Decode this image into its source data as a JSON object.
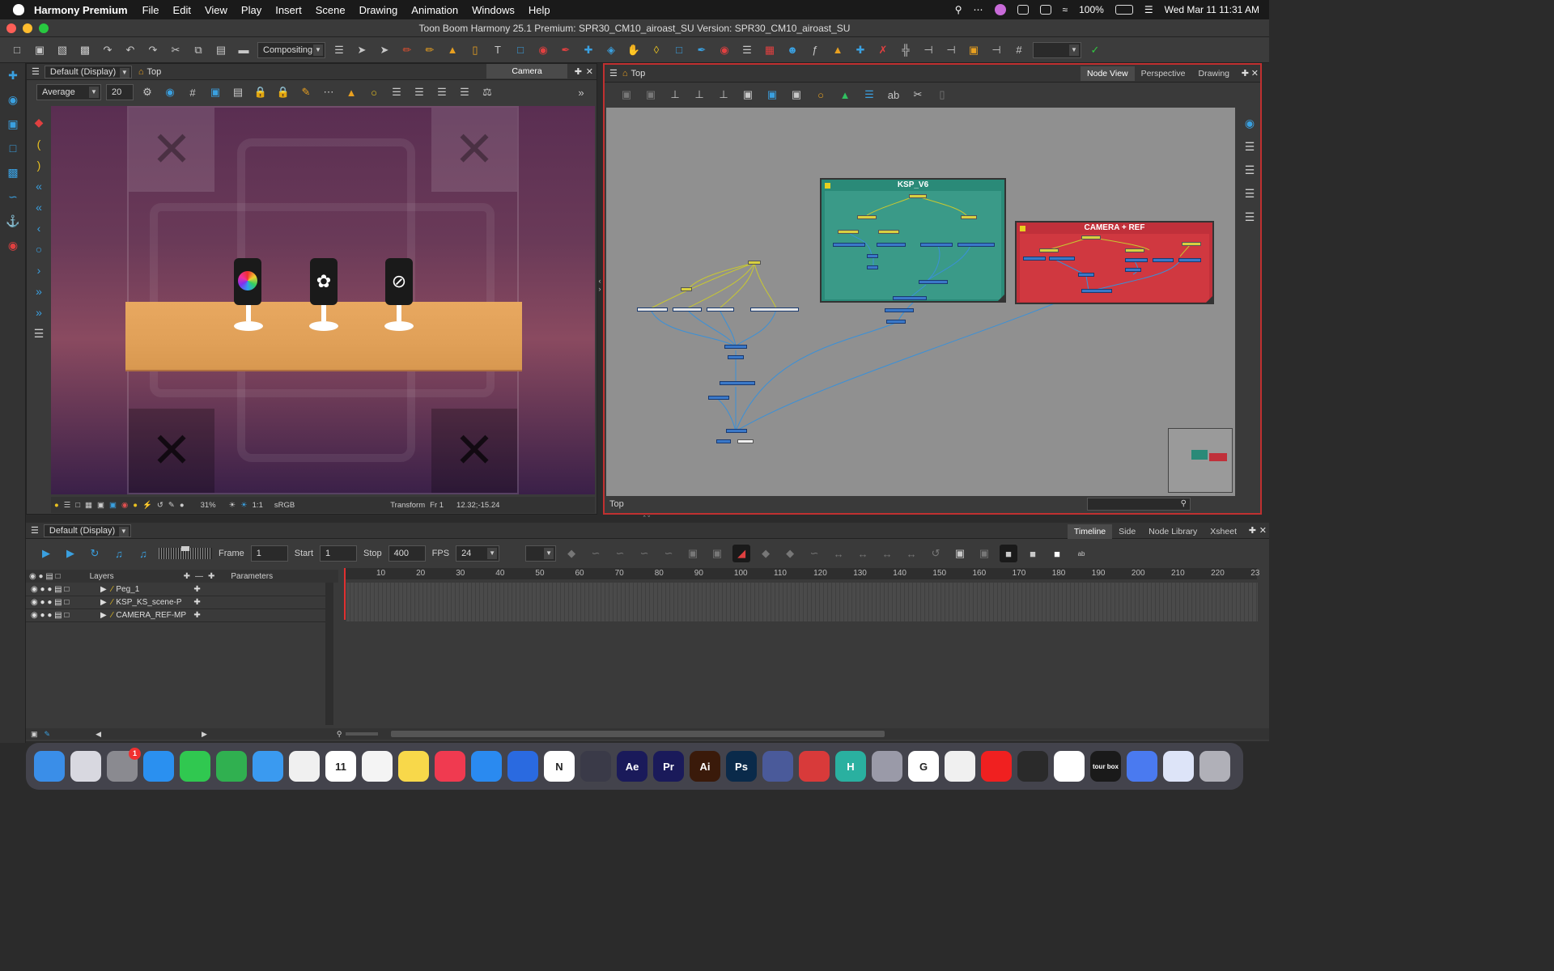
{
  "menubar": {
    "app_name": "Harmony Premium",
    "items": [
      "File",
      "Edit",
      "View",
      "Play",
      "Insert",
      "Scene",
      "Drawing",
      "Animation",
      "Windows",
      "Help"
    ],
    "battery": "100%",
    "clock": "Wed Mar 11  11:31 AM"
  },
  "window": {
    "title": "Toon Boom Harmony 25.1 Premium: SPR30_CM10_airoast_SU Version: SPR30_CM10_airoast_SU"
  },
  "toolbar": {
    "workspace": "Compositing"
  },
  "camera_panel": {
    "display": "Default (Display)",
    "breadcrumb": "Top",
    "tab": "Camera",
    "filter": "Average",
    "filter_value": "20",
    "zoom": "31%",
    "ratio": "1:1",
    "colorspace": "sRGB",
    "status_tool": "Transform",
    "status_frame": "Fr 1",
    "status_coords": "12.32;-15.24"
  },
  "node_panel": {
    "breadcrumb": "Top",
    "tabs": [
      "Node View",
      "Perspective",
      "Drawing"
    ],
    "active_tab": "Node View",
    "footer_label": "Top",
    "groups": [
      {
        "name": "KSP_V6",
        "color": "#2a8a78"
      },
      {
        "name": "CAMERA + REF",
        "color": "#c0303a"
      }
    ]
  },
  "timeline_panel": {
    "display": "Default (Display)",
    "tabs": [
      "Timeline",
      "Side",
      "Node Library",
      "Xsheet"
    ],
    "active_tab": "Timeline",
    "frame_label": "Frame",
    "frame_value": "1",
    "start_label": "Start",
    "start_value": "1",
    "stop_label": "Stop",
    "stop_value": "400",
    "fps_label": "FPS",
    "fps_value": "24",
    "layers_header": "Layers",
    "params_header": "Parameters",
    "layers": [
      "Peg_1",
      "KSP_KS_scene-P",
      "CAMERA_REF-MP"
    ],
    "ruler_ticks": [
      "10",
      "20",
      "30",
      "40",
      "50",
      "60",
      "70",
      "80",
      "90",
      "100",
      "110",
      "120",
      "130",
      "140",
      "150",
      "160",
      "170",
      "180",
      "190",
      "200",
      "210",
      "220",
      "23"
    ]
  },
  "dock": {
    "apps": [
      {
        "name": "finder",
        "label": "",
        "color": "#3a8ee8"
      },
      {
        "name": "launchpad",
        "label": "",
        "color": "#d8d8e0"
      },
      {
        "name": "system-settings",
        "label": "",
        "color": "#8a8a90",
        "badge": "1"
      },
      {
        "name": "safari",
        "label": "",
        "color": "#2a90f0"
      },
      {
        "name": "messages",
        "label": "",
        "color": "#30c850"
      },
      {
        "name": "facetime",
        "label": "",
        "color": "#30b050"
      },
      {
        "name": "mail",
        "label": "",
        "color": "#3a9af0"
      },
      {
        "name": "photos",
        "label": "",
        "color": "#f0f0f0"
      },
      {
        "name": "calendar",
        "label": "11",
        "color": "#ffffff"
      },
      {
        "name": "reminders",
        "label": "",
        "color": "#f4f4f4"
      },
      {
        "name": "notes",
        "label": "",
        "color": "#f8d84a"
      },
      {
        "name": "music",
        "label": "",
        "color": "#f03a50"
      },
      {
        "name": "app-store",
        "label": "",
        "color": "#2a8af0"
      },
      {
        "name": "things",
        "label": "",
        "color": "#2a6ae0"
      },
      {
        "name": "notion",
        "label": "N",
        "color": "#ffffff"
      },
      {
        "name": "activity",
        "label": "",
        "color": "#3a3a48"
      },
      {
        "name": "after-effects",
        "label": "Ae",
        "color": "#1a1a5a"
      },
      {
        "name": "premiere",
        "label": "Pr",
        "color": "#1a1a5a"
      },
      {
        "name": "illustrator",
        "label": "Ai",
        "color": "#3a1a0a"
      },
      {
        "name": "photoshop",
        "label": "Ps",
        "color": "#0a2a4a"
      },
      {
        "name": "remote",
        "label": "",
        "color": "#4a5a9a"
      },
      {
        "name": "scrobbler",
        "label": "",
        "color": "#d83a3a"
      },
      {
        "name": "h-app",
        "label": "H",
        "color": "#2ab0a0"
      },
      {
        "name": "keychain",
        "label": "",
        "color": "#9a9aa8"
      },
      {
        "name": "chrome",
        "label": "G",
        "color": "#ffffff"
      },
      {
        "name": "stocks",
        "label": "",
        "color": "#f0f0f0"
      },
      {
        "name": "youtube",
        "label": "",
        "color": "#f02020"
      },
      {
        "name": "openai",
        "label": "",
        "color": "#2a2a2a"
      },
      {
        "name": "pause",
        "label": "",
        "color": "#ffffff"
      },
      {
        "name": "tour-box",
        "label": "tour box",
        "color": "#1a1a1a"
      },
      {
        "name": "files",
        "label": "",
        "color": "#4a7af0"
      },
      {
        "name": "writer",
        "label": "",
        "color": "#dde4f8"
      },
      {
        "name": "trash",
        "label": "",
        "color": "#b0b0b8"
      }
    ]
  },
  "colors": {
    "accent_blue": "#3aa0e0",
    "accent_yellow": "#e6c020",
    "node_panel_border": "#c03030"
  }
}
